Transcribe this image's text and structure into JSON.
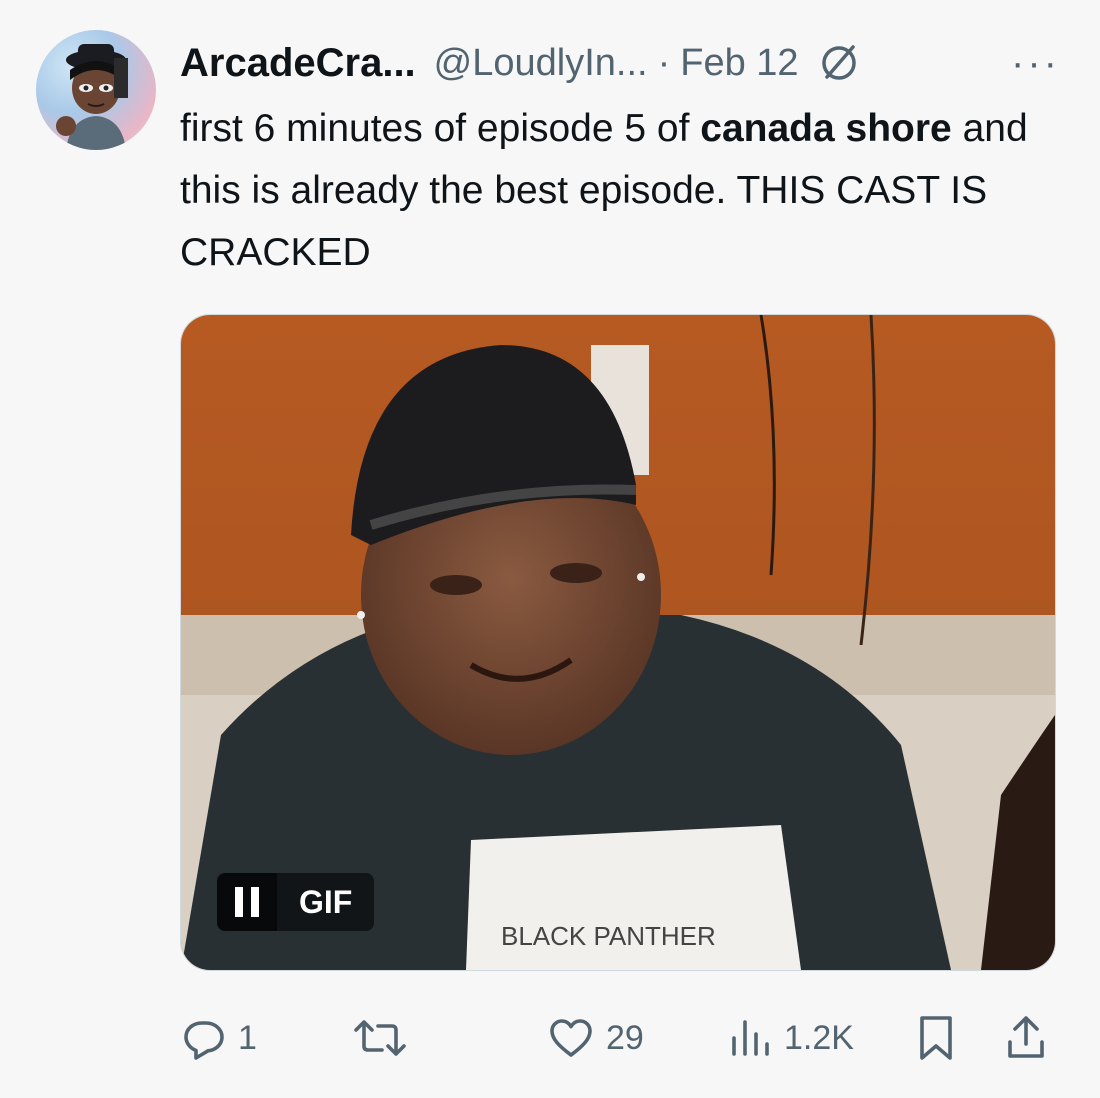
{
  "tweet": {
    "display_name": "ArcadeCra...",
    "handle": "@LoudlyIn...",
    "separator": "·",
    "date": "Feb 12",
    "more_label": "···",
    "text_part1": "first 6 minutes of episode 5 of ",
    "text_bold1": "canada shore",
    "text_part2": " and this is already the best episode. THIS CAST IS CRACKED"
  },
  "media": {
    "gif_label": "GIF",
    "shirt_text": "BLACK PANTHER"
  },
  "actions": {
    "replies": "1",
    "reposts": "",
    "likes": "29",
    "views": "1.2K"
  },
  "icons": [
    "verified-icon",
    "more-icon",
    "pause-icon",
    "reply-icon",
    "repost-icon",
    "like-icon",
    "views-icon",
    "bookmark-icon",
    "share-icon"
  ],
  "colors": {
    "secondary_text": "#536471",
    "text": "#0f1419",
    "background": "#f7f7f7"
  }
}
